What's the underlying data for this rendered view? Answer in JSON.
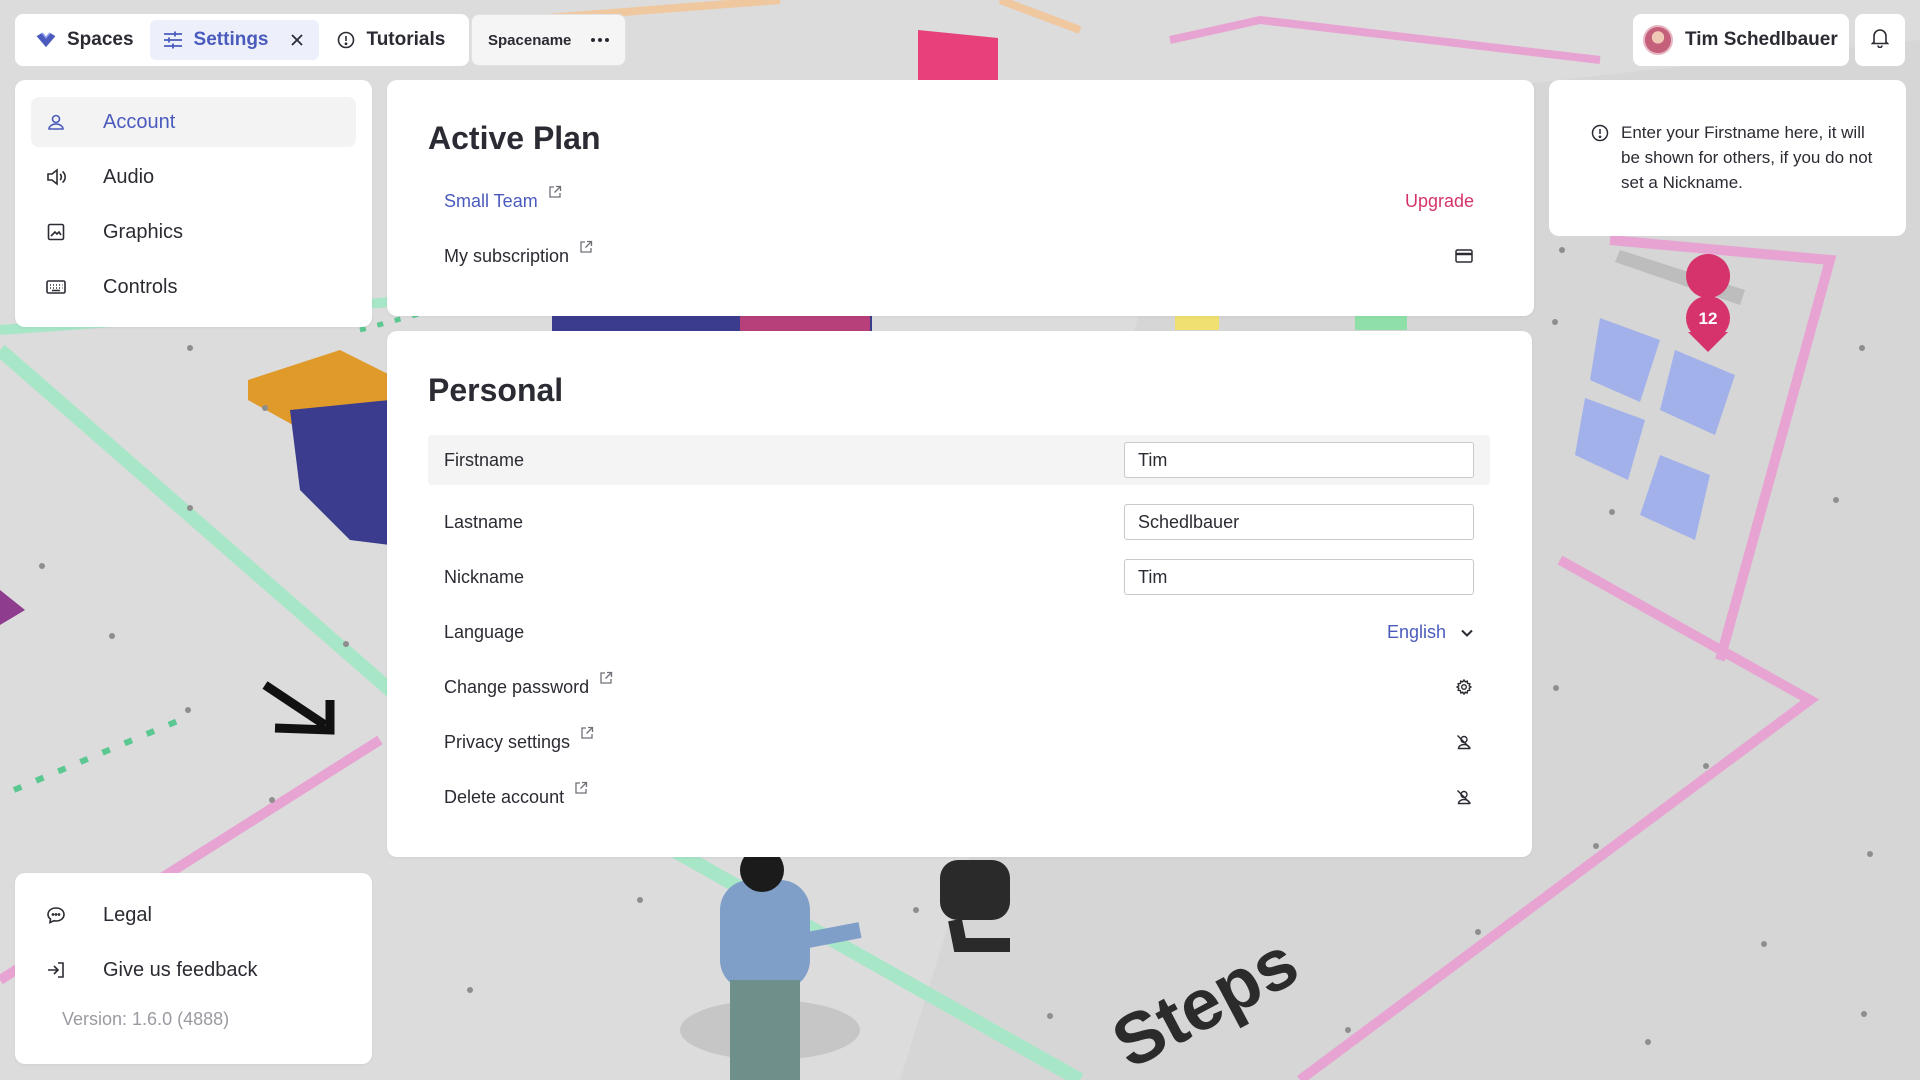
{
  "topbar": {
    "tabs": [
      {
        "label": "Spaces",
        "icon": "logo-icon"
      },
      {
        "label": "Settings",
        "icon": "sliders-icon",
        "active": true
      },
      {
        "label": "Tutorials",
        "icon": "info-circle-icon"
      }
    ],
    "space_name": "Spacename",
    "user_name": "Tim Schedlbauer"
  },
  "sidebar": {
    "items": [
      {
        "label": "Account",
        "icon": "user-icon",
        "active": true
      },
      {
        "label": "Audio",
        "icon": "speaker-icon"
      },
      {
        "label": "Graphics",
        "icon": "image-icon"
      },
      {
        "label": "Controls",
        "icon": "keyboard-icon"
      }
    ],
    "footer_items": [
      {
        "label": "Legal",
        "icon": "chat-bubble-icon"
      },
      {
        "label": "Give us feedback",
        "icon": "login-icon"
      }
    ],
    "version": "Version: 1.6.0 (4888)"
  },
  "active_plan": {
    "title": "Active Plan",
    "plan_name": "Small Team",
    "upgrade_label": "Upgrade",
    "subscription_label": "My subscription"
  },
  "personal": {
    "title": "Personal",
    "firstname_label": "Firstname",
    "firstname_value": "Tim",
    "lastname_label": "Lastname",
    "lastname_value": "Schedlbauer",
    "nickname_label": "Nickname",
    "nickname_value": "Tim",
    "language_label": "Language",
    "language_value": "English",
    "change_password_label": "Change password",
    "privacy_label": "Privacy settings",
    "delete_label": "Delete account"
  },
  "hint": {
    "text": "Enter your Firstname here, it will be shown for others, if you do not set a Nickname."
  },
  "scene": {
    "badge_count": "12",
    "floor_text": "Steps"
  },
  "colors": {
    "accent": "#4a5bbd",
    "pink": "#d6336c",
    "text": "#2b2b33",
    "muted": "#9a9aa2"
  }
}
